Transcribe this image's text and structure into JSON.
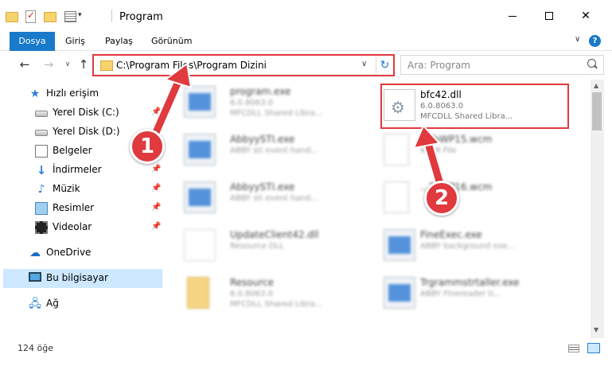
{
  "window": {
    "title": "Program",
    "minimize": "–",
    "maximize": "□",
    "close": "✕"
  },
  "ribbon": {
    "tabs": [
      "Dosya",
      "Giriş",
      "Paylaş",
      "Görünüm"
    ],
    "help": "?"
  },
  "nav": {
    "address": "C:\\Program Files\\Program Dizini",
    "search_placeholder": "Ara: Program"
  },
  "sidebar": {
    "items": [
      {
        "label": "Hızlı erişim",
        "icon": "star-icon"
      },
      {
        "label": "Yerel Disk (C:)",
        "icon": "disk-icon"
      },
      {
        "label": "Yerel Disk (D:)",
        "icon": "disk-icon"
      },
      {
        "label": "Belgeler",
        "icon": "documents-icon"
      },
      {
        "label": "İndirmeler",
        "icon": "download-icon"
      },
      {
        "label": "Müzik",
        "icon": "music-icon"
      },
      {
        "label": "Resimler",
        "icon": "pictures-icon"
      },
      {
        "label": "Videolar",
        "icon": "videos-icon"
      },
      {
        "label": "OneDrive",
        "icon": "cloud-icon"
      },
      {
        "label": "Bu bilgisayar",
        "icon": "computer-icon"
      },
      {
        "label": "Ağ",
        "icon": "network-icon"
      }
    ]
  },
  "files": [
    {
      "name": "program.exe",
      "line1": "6.0.8063.0",
      "line2": "MFCDLL Shared Libra..."
    },
    {
      "name": "bfc42.dll",
      "line1": "6.0.8063.0",
      "line2": "MFCDLL Shared Libra..."
    },
    {
      "name": "AbbyySTI.exe",
      "line1": "ABBY sti event hand...",
      "line2": ""
    },
    {
      "name": "...ToWP15.wcm",
      "line1": "WCM File",
      "line2": ""
    },
    {
      "name": "AbbyySTI.exe",
      "line1": "ABBY sti event hand...",
      "line2": ""
    },
    {
      "name": "...ToWP16.wcm",
      "line1": "",
      "line2": ""
    },
    {
      "name": "UpdateClient42.dll",
      "line1": "Resource DLL",
      "line2": ""
    },
    {
      "name": "FineExec.exe",
      "line1": "ABBY background exe...",
      "line2": ""
    },
    {
      "name": "Resource",
      "line1": "6.0.8063.0",
      "line2": "MFCDLL Shared Libra..."
    },
    {
      "name": "Trgrammstrtaller.exe",
      "line1": "ABBY Finereader ti...",
      "line2": ""
    }
  ],
  "badges": {
    "one": "1",
    "two": "2"
  },
  "status": {
    "count": "124 öğe"
  },
  "colors": {
    "accent": "#1979ca",
    "highlight": "#e0393e",
    "selected": "#cde8ff"
  }
}
